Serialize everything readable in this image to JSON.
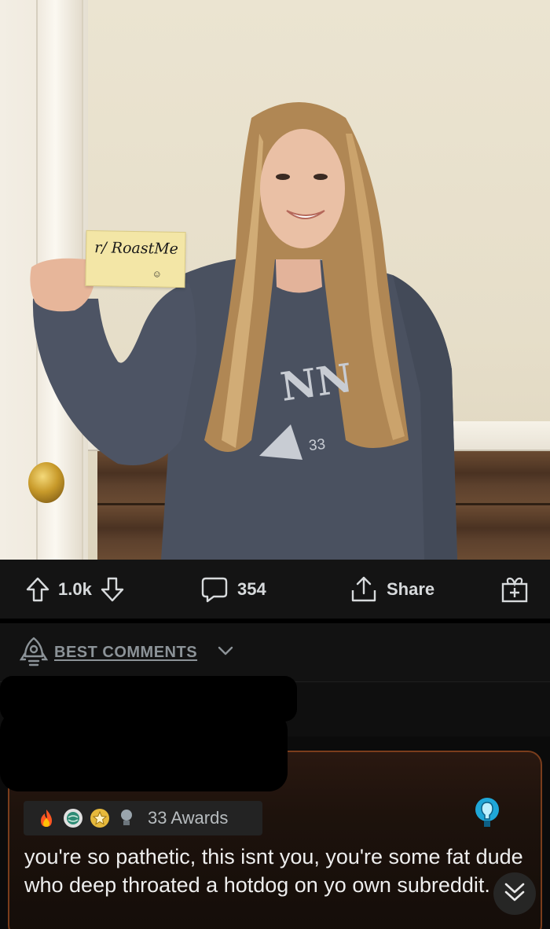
{
  "post": {
    "sign_text": "r/ RoastMe",
    "sign_smile": "☺",
    "sweatshirt_number": "33",
    "sweatshirt_text": "NN"
  },
  "action_bar": {
    "vote_count": "1.0k",
    "comment_count": "354",
    "share_label": "Share",
    "icons": [
      "upvote-icon",
      "downvote-icon",
      "comment-icon",
      "share-icon",
      "gift-icon"
    ]
  },
  "sort": {
    "label": "BEST COMMENTS",
    "icons": [
      "rocket-icon",
      "chevron-down-icon"
    ]
  },
  "comment": {
    "awards_label": "33 Awards",
    "award_icons": [
      "fire-icon",
      "globe-award-icon",
      "star-award-icon",
      "lightbulb-award-icon"
    ],
    "text": "you're so pathetic, this isnt you, you're some fat dude who deep throated a hotdog on yo own subreddit."
  },
  "colors": {
    "bar_bg": "#141414",
    "card_border": "#7a3d1c",
    "text": "#d7dadc"
  }
}
